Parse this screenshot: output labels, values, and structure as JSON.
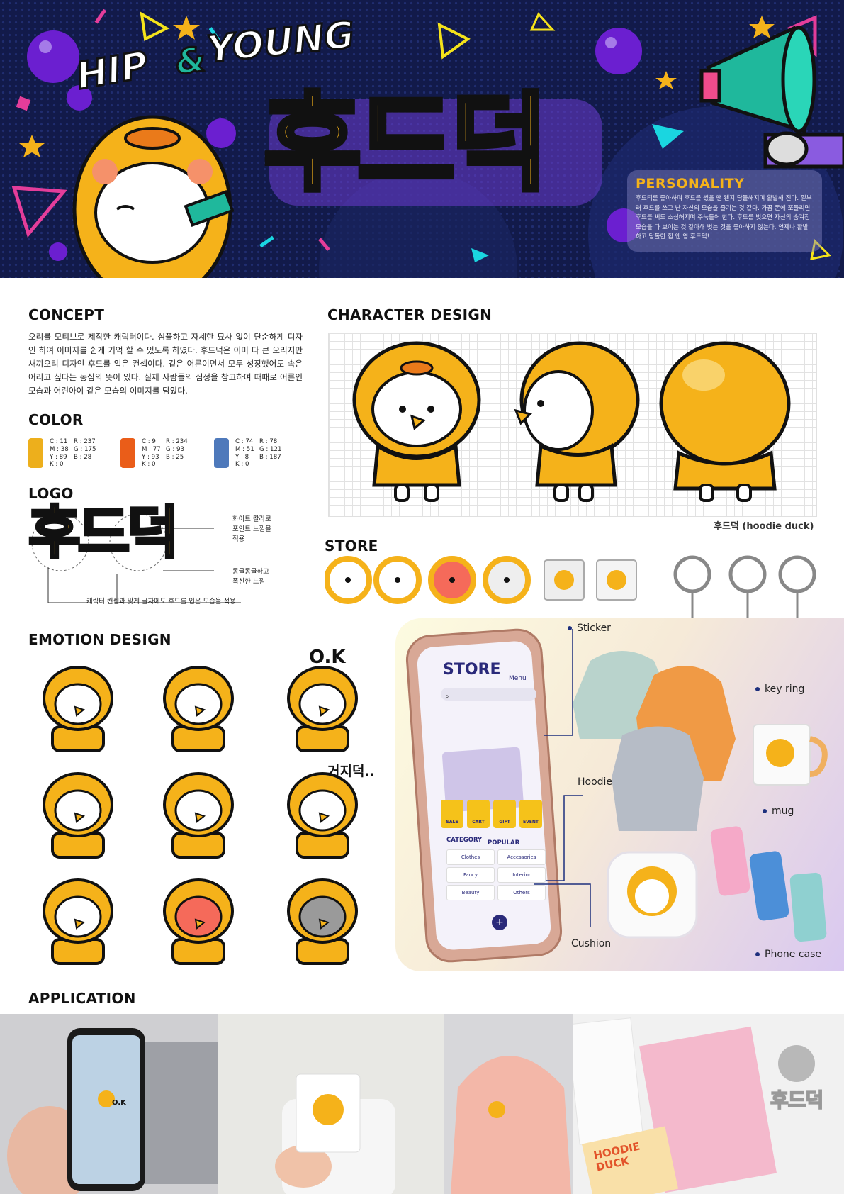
{
  "hero": {
    "tag_left": "HIP",
    "tag_amp": "&",
    "tag_right": "YOUNG",
    "title": "후드덕",
    "personality": {
      "title": "PERSONALITY",
      "text": "후드티를 좋아하며 후드를 썼을 땐 왠지 당돌해지며 활발해 진다. 일부러 후드를 쓰고 난 자신의 모습을 즐기는 것 같다. 가끔 돈에 쪼들리면 후드를 써도 소심해지며 주눅들어 한다. 후드를 벗으면 자신의 숨겨진 모습을 다 보이는 것 같아해 벗는 것을 좋아하지 않는다. 언제나 활발하고 당돌한 힙 앤 영 후드덕!"
    }
  },
  "concept": {
    "heading": "CONCEPT",
    "text": "오리를 모티브로 제작한 캐릭터이다. 심플하고 자세한 묘사 없이 단순하게 디자인 하여 이미지를 쉽게 기억 할 수 있도록 하였다. 후드덕은 이미 다 큰 오리지만 새끼오리 디자인 후드를 입은 컨셉이다. 겉은 어른이면서 모두 성장했어도 속은 어리고 싶다는 동심의 뜻이 있다. 실제 사람들의 심정을 참고하여 때때로 어른인 모습과 어린아이 같은 모습의 이미지를 담았다."
  },
  "color": {
    "heading": "COLOR",
    "swatches": [
      {
        "hex": "#edaf1c",
        "c": "C : 11",
        "m": "M : 38",
        "y": "Y : 89",
        "k": "K : 0",
        "r": "R : 237",
        "g": "G : 175",
        "b": "B : 28"
      },
      {
        "hex": "#ea5d19",
        "c": "C : 9",
        "m": "M : 77",
        "y": "Y : 93",
        "k": "K : 0",
        "r": "R : 234",
        "g": "G : 93",
        "b": "B : 25"
      },
      {
        "hex": "#4e79bb",
        "c": "C : 74",
        "m": "M : 51",
        "y": "Y : 8",
        "k": "K : 0",
        "r": "R : 78",
        "g": "G : 121",
        "b": "B : 187"
      }
    ]
  },
  "logo": {
    "heading": "LOGO",
    "wordmark": "후드덕",
    "note1": "화이트 칼라로\n포인트 느낌을\n적용",
    "note2": "동글동글하고\n폭신한 느낌",
    "note3": "캐릭터 컨셉과 맞게 글자에도 후드를 입은 모습을 적용"
  },
  "character": {
    "heading": "CHARACTER DESIGN",
    "caption": "후드덕 (hoodie duck)"
  },
  "store": {
    "heading": "STORE"
  },
  "emotion": {
    "heading": "EMOTION DESIGN",
    "ok_text": "O.K",
    "liar_text": "거지덕.."
  },
  "phone_ui": {
    "title": "STORE",
    "menu": "Menu",
    "buttons": [
      "SALE",
      "CART",
      "GIFT",
      "EVENT"
    ],
    "tab_category": "CATEGORY",
    "tab_popular": "POPULAR",
    "categories": [
      "Clothes",
      "Accessories",
      "Fancy",
      "Interior",
      "Beauty",
      "Others"
    ]
  },
  "products": {
    "sticker": "Sticker",
    "keyring": "key ring",
    "hoodie": "Hoodie",
    "mug": "mug",
    "cushion": "Cushion",
    "phonecase": "Phone case"
  },
  "application": {
    "heading": "APPLICATION",
    "chat_ok": "O.K",
    "book_title": "HOODIE\nDUCK",
    "brand": "후드덕"
  },
  "colors": {
    "navy": "#121a4a",
    "yellow": "#f5b21a",
    "orange": "#ea5d19",
    "blue": "#4e79bb",
    "text": "#111111"
  }
}
